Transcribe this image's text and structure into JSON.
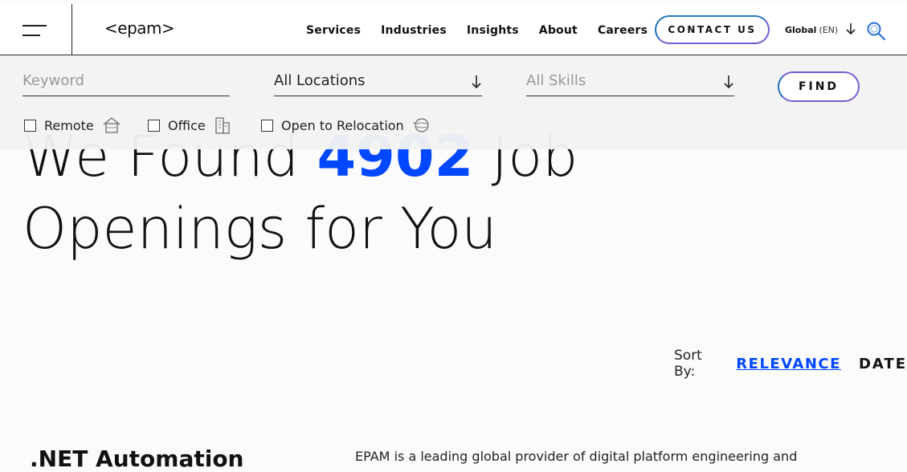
{
  "header": {
    "logo": "<epam>",
    "nav": [
      "Services",
      "Industries",
      "Insights",
      "About",
      "Careers"
    ],
    "contact_label": "CONTACT US",
    "lang_region": "Global",
    "lang_code": "(EN)"
  },
  "hero": {
    "line1_prefix": "We Found",
    "count": "4902",
    "line1_suffix": "Job",
    "line2": "Openings for You"
  },
  "filters": {
    "keyword_placeholder": "Keyword",
    "location_value": "All Locations",
    "skills_placeholder": "All Skills",
    "find_label": "FIND",
    "checkboxes": [
      "Remote",
      "Office",
      "Open to Relocation"
    ]
  },
  "sort": {
    "label": "Sort By:",
    "relevance": "RELEVANCE",
    "date": "DATE"
  },
  "job": {
    "title": ".NET Automation",
    "description": "EPAM is a leading global provider of digital platform engineering and"
  },
  "colors": {
    "accent_blue": "#0047ff",
    "button_gradient_start": "#1b6fb8",
    "button_gradient_end": "#7a5cd0"
  }
}
